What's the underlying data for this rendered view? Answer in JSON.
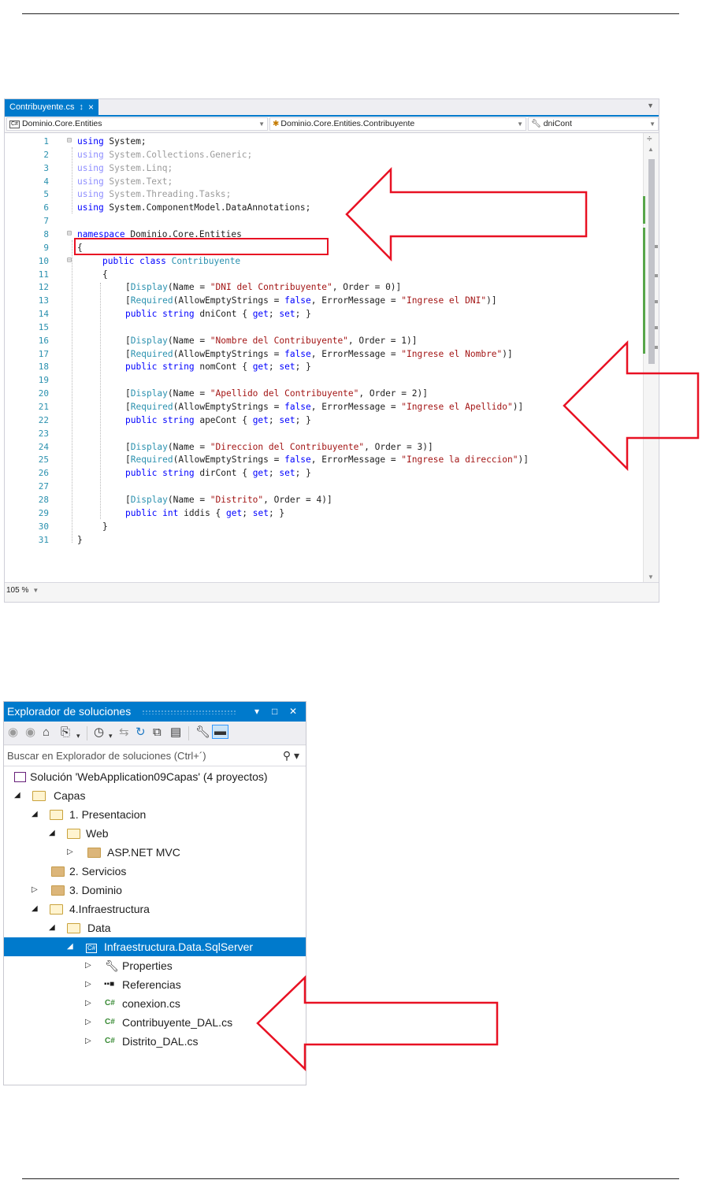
{
  "editor": {
    "tab_title": "Contribuyente.cs",
    "tab_pin": "↕",
    "tab_close": "×",
    "nav_project": "Dominio.Core.Entities",
    "nav_type": "Dominio.Core.Entities.Contribuyente",
    "nav_member": "dniCont",
    "zoom": "105 %",
    "line_numbers": [
      "1",
      "2",
      "3",
      "4",
      "5",
      "6",
      "7",
      "8",
      "9",
      "10",
      "11",
      "12",
      "13",
      "14",
      "15",
      "16",
      "17",
      "18",
      "19",
      "20",
      "21",
      "22",
      "23",
      "24",
      "25",
      "26",
      "27",
      "28",
      "29",
      "30",
      "31"
    ],
    "code": {
      "l1": [
        "using",
        " System;"
      ],
      "l2": [
        "using",
        " System.Collections.Generic;"
      ],
      "l3": [
        "using",
        " System.Linq;"
      ],
      "l4": [
        "using",
        " System.Text;"
      ],
      "l5": [
        "using",
        " System.Threading.Tasks;"
      ],
      "l6": [
        "using",
        " System.ComponentModel.DataAnnotations;"
      ],
      "l8": [
        "namespace",
        " Dominio.Core.Entities"
      ],
      "l9": "{",
      "l10": [
        "public",
        " ",
        "class",
        " ",
        "Contribuyente"
      ],
      "l11": "{",
      "l12": [
        "[",
        "Display",
        "(Name = ",
        "\"DNI del Contribuyente\"",
        ", Order = 0)]"
      ],
      "l13": [
        "[",
        "Required",
        "(AllowEmptyStrings = ",
        "false",
        ", ErrorMessage = ",
        "\"Ingrese el DNI\"",
        ")]"
      ],
      "l14": [
        "public",
        " ",
        "string",
        " dniCont { ",
        "get",
        "; ",
        "set",
        "; }"
      ],
      "l16": [
        "[",
        "Display",
        "(Name = ",
        "\"Nombre del Contribuyente\"",
        ", Order = 1)]"
      ],
      "l17": [
        "[",
        "Required",
        "(AllowEmptyStrings = ",
        "false",
        ", ErrorMessage = ",
        "\"Ingrese el Nombre\"",
        ")]"
      ],
      "l18": [
        "public",
        " ",
        "string",
        " nomCont { ",
        "get",
        "; ",
        "set",
        "; }"
      ],
      "l20": [
        "[",
        "Display",
        "(Name = ",
        "\"Apellido del Contribuyente\"",
        ", Order = 2)]"
      ],
      "l21": [
        "[",
        "Required",
        "(AllowEmptyStrings = ",
        "false",
        ", ErrorMessage = ",
        "\"Ingrese el Apellido\"",
        ")]"
      ],
      "l22": [
        "public",
        " ",
        "string",
        " apeCont { ",
        "get",
        "; ",
        "set",
        "; }"
      ],
      "l24": [
        "[",
        "Display",
        "(Name = ",
        "\"Direccion del Contribuyente\"",
        ", Order = 3)]"
      ],
      "l25": [
        "[",
        "Required",
        "(AllowEmptyStrings = ",
        "false",
        ", ErrorMessage = ",
        "\"Ingrese la direccion\"",
        ")]"
      ],
      "l26": [
        "public",
        " ",
        "string",
        " dirCont { ",
        "get",
        "; ",
        "set",
        "; }"
      ],
      "l28": [
        "[",
        "Display",
        "(Name = ",
        "\"Distrito\"",
        ", Order = 4)]"
      ],
      "l29": [
        "public",
        " ",
        "int",
        " iddis { ",
        "get",
        "; ",
        "set",
        "; }"
      ],
      "l30": "}",
      "l31": "}"
    },
    "colors": {
      "keyword": "#0000ff",
      "type": "#2b91af",
      "string": "#a31515",
      "accent": "#007acc",
      "highlight": "#e81123"
    }
  },
  "solution_explorer": {
    "title": "Explorador de soluciones",
    "title_controls": [
      "▾",
      "□",
      "✕"
    ],
    "search_placeholder": "Buscar en Explorador de soluciones (Ctrl+´)",
    "tree": [
      {
        "label": "Solución 'WebApplication09Capas'  (4 proyectos)",
        "kind": "solution"
      },
      {
        "label": "Capas",
        "kind": "folder-open"
      },
      {
        "label": "1. Presentacion",
        "kind": "folder-open"
      },
      {
        "label": "Web",
        "kind": "folder-open"
      },
      {
        "label": "ASP.NET MVC",
        "kind": "folder-closed"
      },
      {
        "label": "2. Servicios",
        "kind": "folder-closed"
      },
      {
        "label": "3. Dominio",
        "kind": "folder-closed"
      },
      {
        "label": "4.Infraestructura",
        "kind": "folder-open"
      },
      {
        "label": "Data",
        "kind": "folder-open"
      },
      {
        "label": "Infraestructura.Data.SqlServer",
        "kind": "csproj",
        "selected": true
      },
      {
        "label": "Properties",
        "kind": "wrench"
      },
      {
        "label": "Referencias",
        "kind": "references"
      },
      {
        "label": "conexion.cs",
        "kind": "csfile"
      },
      {
        "label": "Contribuyente_DAL.cs",
        "kind": "csfile"
      },
      {
        "label": "Distrito_DAL.cs",
        "kind": "csfile"
      }
    ]
  }
}
